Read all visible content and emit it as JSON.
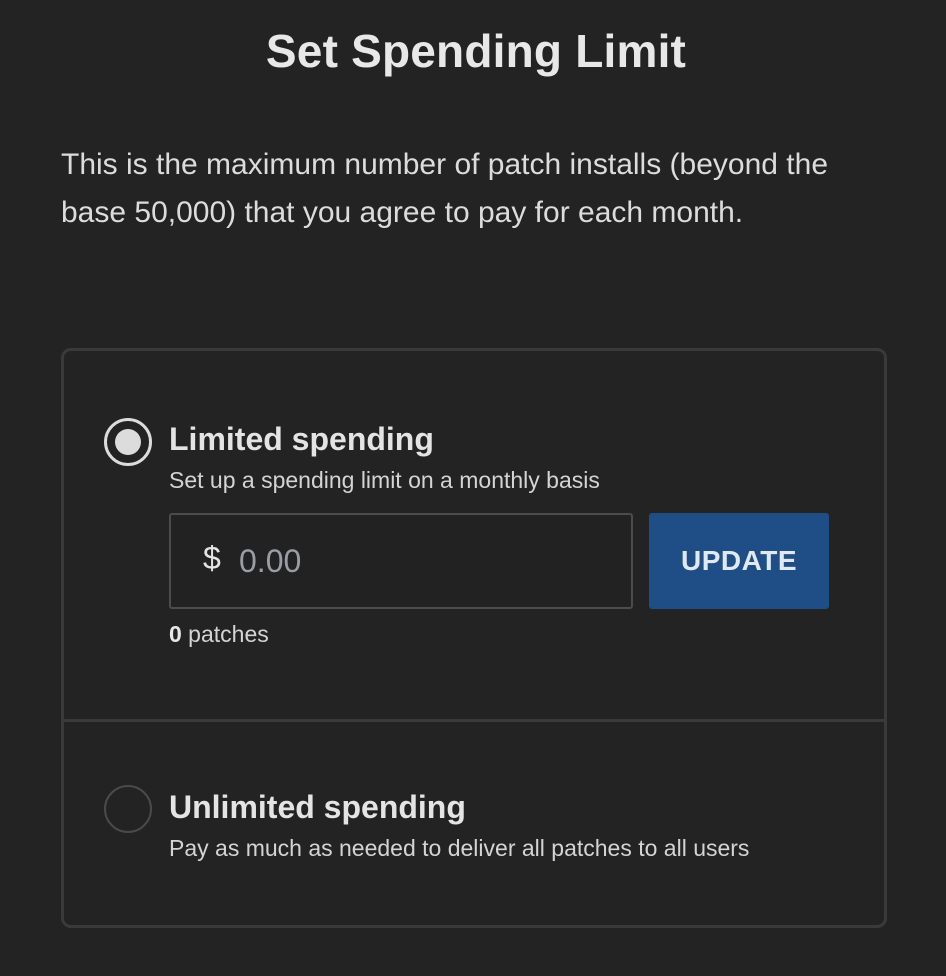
{
  "page": {
    "title": "Set Spending Limit",
    "description": "This is the maximum number of patch installs (beyond the base 50,000) that you agree to pay for each month."
  },
  "options": {
    "limited": {
      "label": "Limited spending",
      "description": "Set up a spending limit on a monthly basis",
      "selected": true,
      "currency_symbol": "$",
      "amount_placeholder": "0.00",
      "amount_value": "",
      "update_label": "UPDATE",
      "patches_count": "0",
      "patches_suffix": " patches"
    },
    "unlimited": {
      "label": "Unlimited spending",
      "description": "Pay as much as needed to deliver all patches to all users",
      "selected": false
    }
  },
  "colors": {
    "background": "#232323",
    "panel_border": "#3a3a3a",
    "button": "#1f4d86",
    "text": "#e6e6e6"
  }
}
